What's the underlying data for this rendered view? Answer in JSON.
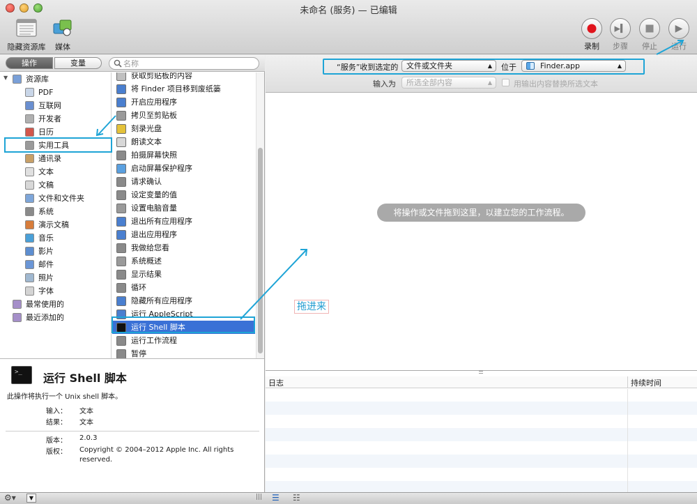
{
  "window": {
    "title": "未命名 (服务) — 已编辑"
  },
  "toolbar": {
    "hide_library_label": "隐藏资源库",
    "media_label": "媒体",
    "record_label": "录制",
    "step_label": "步骤",
    "stop_label": "停止",
    "run_label": "运行"
  },
  "library": {
    "tab_actions": "操作",
    "tab_variables": "变量",
    "search_placeholder": "名称",
    "root": "资源库",
    "categories": [
      "PDF",
      "互联网",
      "开发者",
      "日历",
      "实用工具",
      "通讯录",
      "文本",
      "文稿",
      "文件和文件夹",
      "系统",
      "演示文稿",
      "音乐",
      "影片",
      "邮件",
      "照片",
      "字体"
    ],
    "selected_category": "实用工具",
    "smart_groups": [
      "最常使用的",
      "最近添加的"
    ]
  },
  "actions": [
    "获取剪贴板的内容",
    "将 Finder 项目移到废纸篓",
    "开启应用程序",
    "拷贝至剪贴板",
    "刻录光盘",
    "朗读文本",
    "拍摄屏幕快照",
    "启动屏幕保护程序",
    "请求确认",
    "设定变量的值",
    "设置电脑音量",
    "退出所有应用程序",
    "退出应用程序",
    "我做给您看",
    "系统概述",
    "显示结果",
    "循环",
    "隐藏所有应用程序",
    "运行 AppleScript",
    "运行 Shell 脚本",
    "运行工作流程",
    "暂停"
  ],
  "selected_action": "运行 Shell 脚本",
  "description": {
    "title": "运行 Shell 脚本",
    "summary": "此操作将执行一个 Unix shell 脚本。",
    "input_label": "输入：",
    "input_value": "文本",
    "result_label": "结果：",
    "result_value": "文本",
    "version_label": "版本：",
    "version_value": "2.0.3",
    "copyright_label": "版权：",
    "copyright_value": "Copyright © 2004–2012 Apple Inc.  All rights reserved."
  },
  "service": {
    "receives_label": "“服务”收到选定的",
    "receives_value": "文件或文件夹",
    "in_label": "位于",
    "in_value": "Finder.app",
    "input_is_label": "输入为",
    "input_is_value": "所选全部内容",
    "replace_label": "用输出内容替换所选文本"
  },
  "workflow": {
    "drop_hint": "将操作或文件拖到这里，以建立您的工作流程。",
    "drag_tip": "拖进来"
  },
  "log": {
    "col_log": "日志",
    "col_duration": "持续时间"
  },
  "colors": {
    "accent": "#1ea4d6",
    "selection": "#3a71d6",
    "record": "#e0141c"
  },
  "icons": [
    "gear-icon",
    "chevron-down-icon",
    "list-view-icon",
    "flow-view-icon"
  ]
}
